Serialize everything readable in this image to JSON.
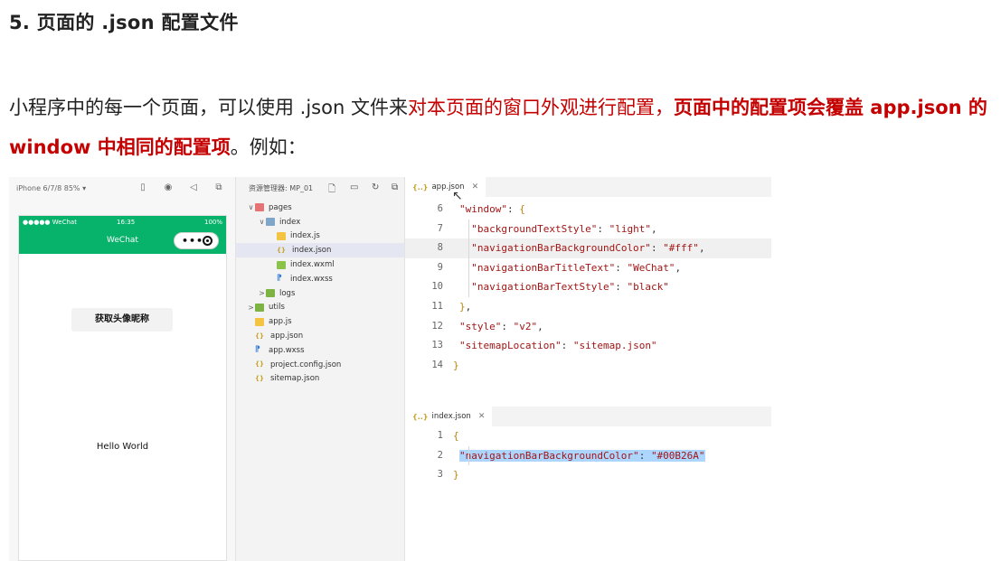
{
  "heading": "5. 页面的 .json 配置文件",
  "paragraph": {
    "part1": "小程序中的每一个页面，可以使用 .json 文件来",
    "part2_red": "对本页面的窗口外观进行配置，",
    "part3_bold_red": "页面中的配置项会覆盖 app.json 的 window 中相同的配置项",
    "part4": "。例如："
  },
  "simulator": {
    "device_label": "iPhone 6/7/8 85% ▾",
    "status_left": "●●●●● WeChat",
    "status_time": "16:35",
    "status_right": "100%",
    "nav_title": "WeChat",
    "capsule_dots": "•••",
    "avatar_button": "获取头像昵称",
    "hello": "Hello World",
    "header_color": "#07B26A"
  },
  "explorer": {
    "title": "资源管理器: MP_01",
    "tree": [
      {
        "chev": "∨",
        "icon": "folder-red",
        "label": "pages",
        "indent": 0
      },
      {
        "chev": "∨",
        "icon": "folder-blue",
        "label": "index",
        "indent": 1
      },
      {
        "chev": "",
        "icon": "js",
        "label": "index.js",
        "indent": 2
      },
      {
        "chev": "",
        "icon": "json",
        "label": "index.json",
        "indent": 2,
        "selected": true
      },
      {
        "chev": "",
        "icon": "wxml",
        "label": "index.wxml",
        "indent": 2
      },
      {
        "chev": "",
        "icon": "wxss",
        "label": "index.wxss",
        "indent": 2
      },
      {
        "chev": ">",
        "icon": "folder-green",
        "label": "logs",
        "indent": 1
      },
      {
        "chev": ">",
        "icon": "folder-green",
        "label": "utils",
        "indent": 0
      },
      {
        "chev": "",
        "icon": "js",
        "label": "app.js",
        "indent": 0
      },
      {
        "chev": "",
        "icon": "json",
        "label": "app.json",
        "indent": 0
      },
      {
        "chev": "",
        "icon": "wxss",
        "label": "app.wxss",
        "indent": 0
      },
      {
        "chev": "",
        "icon": "json",
        "label": "project.config.json",
        "indent": 0
      },
      {
        "chev": "",
        "icon": "json",
        "label": "sitemap.json",
        "indent": 0
      }
    ]
  },
  "editor_top": {
    "tab_label": "app.json",
    "tab_icon": "{..}",
    "lines": [
      {
        "n": "6",
        "html": "<span class=\"s\">\"window\"</span><span class=\"p\">: </span><span class=\"b\">{</span>"
      },
      {
        "n": "7",
        "html": "  <span class=\"s\">\"backgroundTextStyle\"</span><span class=\"p\">: </span><span class=\"s\">\"light\"</span><span class=\"p\">,</span>"
      },
      {
        "n": "8",
        "html": "  <span class=\"s\">\"navigationBarBackgroundColor\"</span><span class=\"p\">: </span><span class=\"s\">\"#fff\"</span><span class=\"p\">,</span>",
        "highlight": true
      },
      {
        "n": "9",
        "html": "  <span class=\"s\">\"navigationBarTitleText\"</span><span class=\"p\">: </span><span class=\"s\">\"WeChat\"</span><span class=\"p\">,</span>"
      },
      {
        "n": "10",
        "html": "  <span class=\"s\">\"navigationBarTextStyle\"</span><span class=\"p\">: </span><span class=\"s\">\"black\"</span>"
      },
      {
        "n": "11",
        "html": "<span class=\"b\">}</span><span class=\"p\">,</span>"
      },
      {
        "n": "12",
        "html": "<span class=\"s\">\"style\"</span><span class=\"p\">: </span><span class=\"s\">\"v2\"</span><span class=\"p\">,</span>"
      },
      {
        "n": "13",
        "html": "<span class=\"s\">\"sitemapLocation\"</span><span class=\"p\">: </span><span class=\"s\">\"sitemap.json\"</span>"
      },
      {
        "n": "14",
        "html": "<span class=\"b\">}</span>",
        "shift": -1
      }
    ]
  },
  "editor_bottom": {
    "tab_label": "index.json",
    "tab_icon": "{..}",
    "lines": [
      {
        "n": "1",
        "html": "<span class=\"b\">{</span>",
        "shift": -1
      },
      {
        "n": "2",
        "html": "<span class=\"hl-sel\"><span class=\"s\">\"navigationBarBackgroundColor\"</span><span class=\"p\">: </span><span class=\"s\">\"#00B26A\"</span></span>"
      },
      {
        "n": "3",
        "html": "<span class=\"b\">}</span>",
        "shift": -1
      }
    ]
  },
  "colors": {
    "accent_red": "#C40000",
    "wechat_green": "#07B26A"
  }
}
